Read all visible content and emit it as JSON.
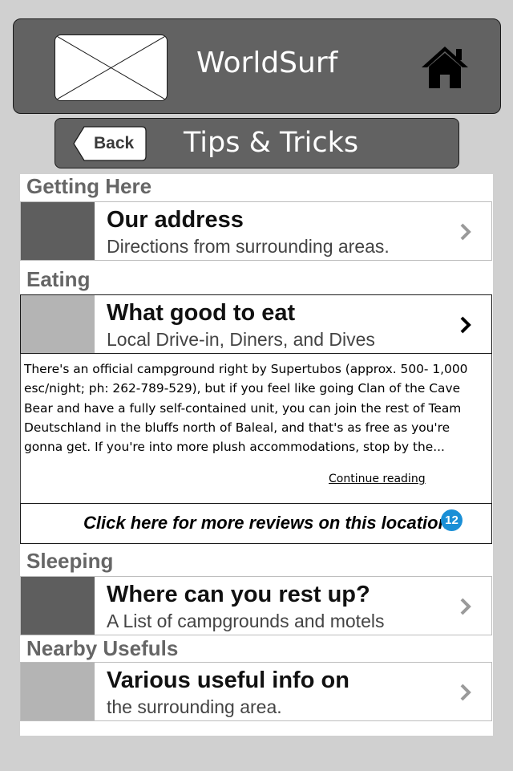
{
  "header": {
    "app_title": "WorldSurf",
    "logo_icon": "image-placeholder-icon",
    "home_icon": "home-icon"
  },
  "subheader": {
    "back_label": "Back",
    "page_title": "Tips & Tricks"
  },
  "sections": {
    "getting_here": {
      "header": "Getting Here",
      "item": {
        "title": "Our address",
        "subtitle": "Directions from surrounding areas.",
        "thumb_color": "#5e5e5e"
      }
    },
    "eating": {
      "header": "Eating",
      "item": {
        "title": "What good to eat",
        "subtitle": "Local Drive-in, Diners, and Dives",
        "thumb_color": "#b4b4b4"
      },
      "detail": {
        "text": "There's an official campground right by Supertubos (approx. 500- 1,000 esc/night; ph: 262-789-529), but if you feel like going Clan of the Cave Bear and have a fully self-contained unit, you can join the rest of Team Deutschland in the bluffs north of Baleal, and that's as free as you're gonna get. If you're into more plush accommodations, stop by the...",
        "continue_label": "Continue reading",
        "reviews_label": "Click here for more reviews on this location",
        "reviews_count": "12"
      }
    },
    "sleeping": {
      "header": "Sleeping",
      "item": {
        "title": "Where can you rest up?",
        "subtitle": "A List of campgrounds and motels",
        "thumb_color": "#5e5e5e"
      }
    },
    "nearby": {
      "header": "Nearby Usefuls",
      "item": {
        "title": "Various useful info on",
        "subtitle": "the surrounding area.",
        "thumb_color": "#b4b4b4"
      }
    }
  },
  "colors": {
    "bar": "#626262",
    "background": "#d0d0d0",
    "badge": "#1a8fd6"
  }
}
